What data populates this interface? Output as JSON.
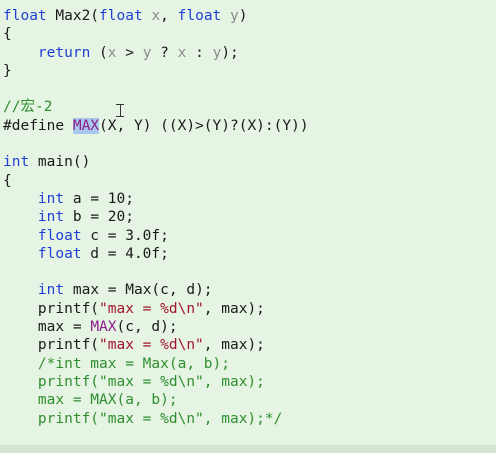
{
  "editor": {
    "lines": [
      {
        "segments": [
          {
            "t": "float",
            "c": "kw"
          },
          {
            "t": " Max2(",
            "c": ""
          },
          {
            "t": "float",
            "c": "kw"
          },
          {
            "t": " ",
            "c": ""
          },
          {
            "t": "x",
            "c": "gray"
          },
          {
            "t": ", ",
            "c": ""
          },
          {
            "t": "float",
            "c": "kw"
          },
          {
            "t": " ",
            "c": ""
          },
          {
            "t": "y",
            "c": "gray"
          },
          {
            "t": ")",
            "c": ""
          }
        ]
      },
      {
        "segments": [
          {
            "t": "{",
            "c": ""
          }
        ]
      },
      {
        "segments": [
          {
            "t": "    ",
            "c": ""
          },
          {
            "t": "return",
            "c": "kw"
          },
          {
            "t": " (",
            "c": ""
          },
          {
            "t": "x",
            "c": "gray"
          },
          {
            "t": " > ",
            "c": ""
          },
          {
            "t": "y",
            "c": "gray"
          },
          {
            "t": " ? ",
            "c": ""
          },
          {
            "t": "x",
            "c": "gray"
          },
          {
            "t": " : ",
            "c": ""
          },
          {
            "t": "y",
            "c": "gray"
          },
          {
            "t": ");",
            "c": ""
          }
        ]
      },
      {
        "segments": [
          {
            "t": "}",
            "c": ""
          }
        ]
      },
      {
        "segments": []
      },
      {
        "segments": [
          {
            "t": "//宏-2",
            "c": "cmt"
          }
        ]
      },
      {
        "segments": [
          {
            "t": "#define",
            "c": ""
          },
          {
            "t": " ",
            "c": ""
          },
          {
            "t": "MAX",
            "c": "hl"
          },
          {
            "t": "(X, Y) ((X)>(Y)?(X):(Y))",
            "c": ""
          }
        ]
      },
      {
        "segments": []
      },
      {
        "segments": [
          {
            "t": "int",
            "c": "kw"
          },
          {
            "t": " main()",
            "c": ""
          }
        ]
      },
      {
        "segments": [
          {
            "t": "{",
            "c": ""
          }
        ]
      },
      {
        "segments": [
          {
            "t": "    ",
            "c": ""
          },
          {
            "t": "int",
            "c": "kw"
          },
          {
            "t": " a = 10;",
            "c": ""
          }
        ]
      },
      {
        "segments": [
          {
            "t": "    ",
            "c": ""
          },
          {
            "t": "int",
            "c": "kw"
          },
          {
            "t": " b = 20;",
            "c": ""
          }
        ]
      },
      {
        "segments": [
          {
            "t": "    ",
            "c": ""
          },
          {
            "t": "float",
            "c": "kw"
          },
          {
            "t": " c = 3.0f;",
            "c": ""
          }
        ]
      },
      {
        "segments": [
          {
            "t": "    ",
            "c": ""
          },
          {
            "t": "float",
            "c": "kw"
          },
          {
            "t": " d = 4.0f;",
            "c": ""
          }
        ]
      },
      {
        "segments": []
      },
      {
        "segments": [
          {
            "t": "    ",
            "c": ""
          },
          {
            "t": "int",
            "c": "kw"
          },
          {
            "t": " max = Max(c, d);",
            "c": ""
          }
        ]
      },
      {
        "segments": [
          {
            "t": "    printf(",
            "c": ""
          },
          {
            "t": "\"max = %d\\n\"",
            "c": "str"
          },
          {
            "t": ", max);",
            "c": ""
          }
        ]
      },
      {
        "segments": [
          {
            "t": "    max = ",
            "c": ""
          },
          {
            "t": "MAX",
            "c": "macro"
          },
          {
            "t": "(c, d);",
            "c": ""
          }
        ]
      },
      {
        "segments": [
          {
            "t": "    printf(",
            "c": ""
          },
          {
            "t": "\"max = %d\\n\"",
            "c": "str"
          },
          {
            "t": ", max);",
            "c": ""
          }
        ]
      },
      {
        "segments": [
          {
            "t": "    /*int max = Max(a, b);",
            "c": "cmt"
          }
        ]
      },
      {
        "segments": [
          {
            "t": "    printf(\"max = %d\\n\", max);",
            "c": "cmt"
          }
        ]
      },
      {
        "segments": [
          {
            "t": "    max = MAX(a, b);",
            "c": "cmt"
          }
        ]
      },
      {
        "segments": [
          {
            "t": "    printf(\"max = %d\\n\", max);*/",
            "c": "cmt"
          }
        ]
      }
    ]
  },
  "cursor": {
    "icon": "text-cursor-icon"
  },
  "colors": {
    "background": "#e6f4e4",
    "keyword": "#1f3fd6",
    "parameter": "#8a8a8a",
    "string": "#a3152b",
    "macro": "#8b1e8b",
    "comment": "#2f8f2f",
    "selection": "#a9c8ee"
  }
}
